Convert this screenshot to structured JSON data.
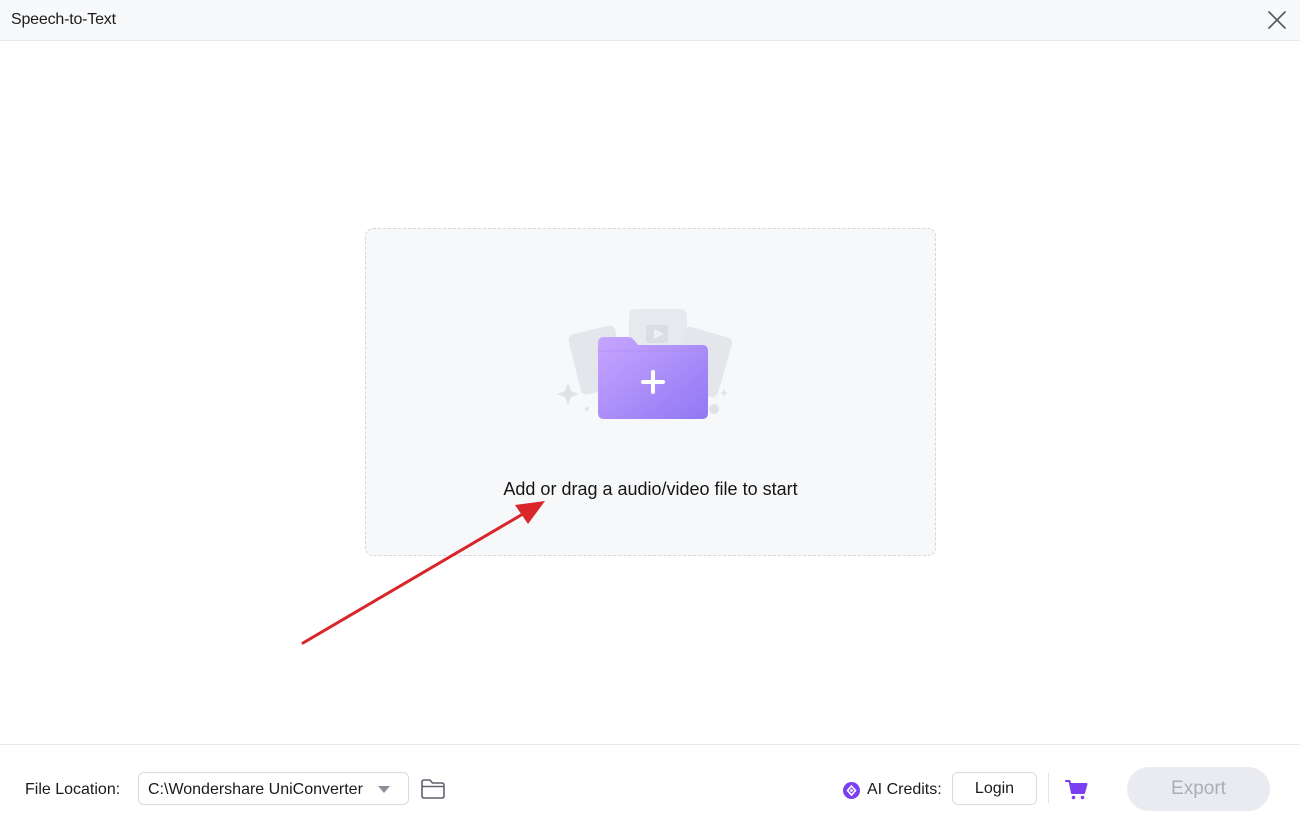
{
  "window": {
    "title": "Speech-to-Text"
  },
  "dropzone": {
    "text": "Add or drag a audio/video file to start"
  },
  "footer": {
    "file_location_label": "File Location:",
    "path_value": "C:\\Wondershare UniConverter",
    "ai_credits_label": "AI Credits:",
    "login_label": "Login",
    "export_label": "Export"
  },
  "colors": {
    "accent_purple": "#9b7cf6",
    "annotation_arrow": "#d9262b",
    "disabled_button_bg": "#e9ebf1"
  },
  "icons": {
    "close": "close-icon",
    "add_file": "folder-plus-illustration",
    "folder": "folder-icon",
    "credits": "ai-credits-icon",
    "cart": "cart-icon"
  }
}
